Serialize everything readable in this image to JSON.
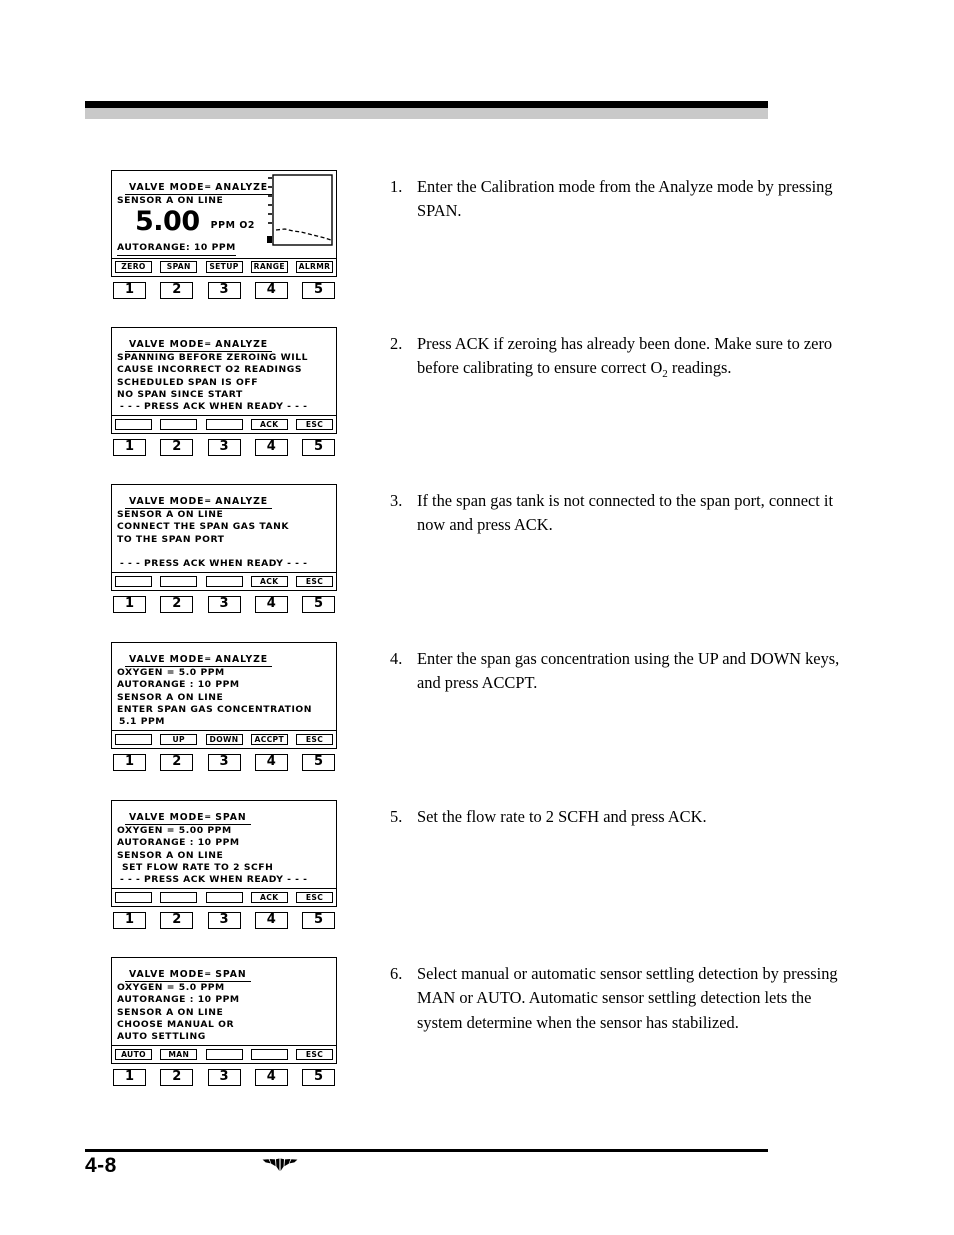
{
  "page": {
    "footer_page_number": "4-8",
    "logo_name": "teledyne-logo"
  },
  "steps": [
    {
      "number": "1.",
      "text": "Enter the Calibration mode from the Analyze mode by pressing SPAN.",
      "panel": {
        "title": "VALVE MODE",
        "title_sep": "=",
        "title_value": "ANALYZE",
        "lines": [
          "SENSOR A ON LINE"
        ],
        "reading_value": "5.00",
        "reading_units": "PPM O2",
        "bottom_line": "AUTORANGE: 10 PPM",
        "has_trend_graph": true,
        "softkeys": [
          "ZERO",
          "SPAN",
          "SETUP",
          "RANGE",
          "ALRMR"
        ],
        "numkeys": [
          "1",
          "2",
          "3",
          "4",
          "5"
        ]
      }
    },
    {
      "number": "2.",
      "text_parts": {
        "before": "Press ACK if zeroing has already been done. Make sure to zero before calibrating to ensure correct O",
        "sub": "2",
        "after": " readings."
      },
      "panel": {
        "title": "VALVE MODE",
        "title_sep": "=",
        "title_value": "ANALYZE",
        "lines": [
          "SPANNING BEFORE ZEROING WILL",
          "CAUSE INCORRECT O2 READINGS",
          "SCHEDULED SPAN IS OFF",
          "NO SPAN SINCE START",
          "- - - PRESS ACK WHEN READY - - -"
        ],
        "softkeys": [
          "",
          "",
          "",
          "ACK",
          "ESC"
        ],
        "numkeys": [
          "1",
          "2",
          "3",
          "4",
          "5"
        ]
      }
    },
    {
      "number": "3.",
      "text": "If the span gas tank is not connected to the span port, connect it now and press ACK.",
      "panel": {
        "title": "VALVE MODE",
        "title_sep": "=",
        "title_value": "ANALYZE",
        "lines": [
          "SENSOR A ON LINE",
          "CONNECT THE SPAN GAS TANK",
          "TO THE SPAN PORT",
          "",
          "- - - PRESS ACK WHEN READY - - -"
        ],
        "softkeys": [
          "",
          "",
          "",
          "ACK",
          "ESC"
        ],
        "numkeys": [
          "1",
          "2",
          "3",
          "4",
          "5"
        ]
      }
    },
    {
      "number": "4.",
      "text": "Enter the span gas concentration using the UP and DOWN keys, and press ACCPT.",
      "panel": {
        "title": "VALVE MODE",
        "title_sep": "=",
        "title_value": "ANALYZE",
        "lines": [
          "OXYGEN =   5.0 PPM",
          "AUTORANGE : 10 PPM",
          "SENSOR A ON LINE",
          "ENTER SPAN GAS CONCENTRATION"
        ],
        "entry_value": "5.1",
        "entry_units": "PPM",
        "softkeys": [
          "",
          "UP",
          "DOWN",
          "ACCPT",
          "ESC"
        ],
        "numkeys": [
          "1",
          "2",
          "3",
          "4",
          "5"
        ]
      }
    },
    {
      "number": "5.",
      "text": "Set the flow rate to 2 SCFH and press ACK.",
      "panel": {
        "title": "VALVE MODE",
        "title_sep": "=",
        "title_value": "SPAN",
        "lines": [
          "OXYGEN =  5.00 PPM",
          "AUTORANGE : 10 PPM",
          "SENSOR A ON LINE",
          "SET FLOW RATE TO 2 SCFH",
          "- - - PRESS ACK WHEN READY - - -"
        ],
        "softkeys": [
          "",
          "",
          "",
          "ACK",
          "ESC"
        ],
        "numkeys": [
          "1",
          "2",
          "3",
          "4",
          "5"
        ]
      }
    },
    {
      "number": "6.",
      "text": "Select manual or automatic sensor settling detection by pressing MAN or AUTO. Automatic sensor settling detection lets the system determine when the sensor has stabilized.",
      "panel": {
        "title": "VALVE MODE",
        "title_sep": "=",
        "title_value": "SPAN",
        "lines": [
          "OXYGEN =  5.0 PPM",
          "AUTORANGE : 10 PPM",
          "SENSOR A ON LINE",
          "CHOOSE MANUAL OR",
          "AUTO SETTLING"
        ],
        "softkeys": [
          "AUTO",
          "MAN",
          "",
          "",
          "ESC"
        ],
        "numkeys": [
          "1",
          "2",
          "3",
          "4",
          "5"
        ]
      }
    }
  ]
}
